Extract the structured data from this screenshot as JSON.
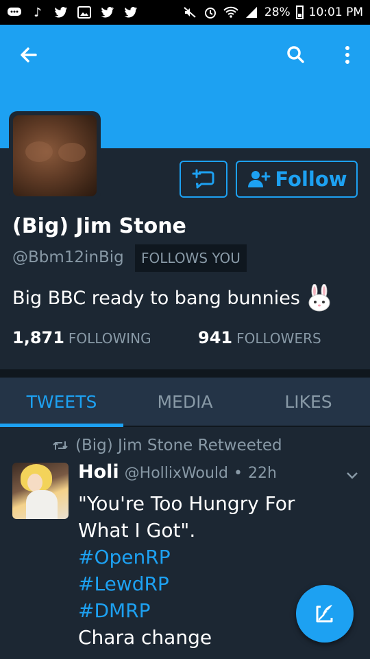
{
  "status_bar": {
    "battery_percent": "28%",
    "time": "10:01 PM"
  },
  "profile": {
    "name": "(Big) Jim Stone",
    "handle": "@Bbm12inBig",
    "follows_you_badge": "FOLLOWS YOU",
    "bio": "Big BBC ready to bang bunnies",
    "follow_label": "Follow",
    "following_count": "1,871",
    "following_label": "FOLLOWING",
    "followers_count": "941",
    "followers_label": "FOLLOWERS"
  },
  "tabs": [
    {
      "label": "TWEETS",
      "active": true
    },
    {
      "label": "MEDIA",
      "active": false
    },
    {
      "label": "LIKES",
      "active": false
    }
  ],
  "tweet": {
    "retweet_note": "(Big) Jim Stone Retweeted",
    "author_name": "Holi",
    "author_handle": "@HollixWould",
    "separator": "•",
    "time": "22h",
    "text_line1": "\"You're Too Hungry For",
    "text_line2": "What I Got\".",
    "hashtags": [
      "#OpenRP",
      "#LewdRP",
      "#DMRP"
    ],
    "text_line3": "Chara change"
  },
  "colors": {
    "accent": "#1da1f2",
    "background": "#1c2733",
    "tab_background": "#243447",
    "muted_text": "#8899a6"
  },
  "icons": {
    "back": "arrow-left-icon",
    "search": "search-icon",
    "more": "more-vertical-icon",
    "dm": "direct-message-icon",
    "follow": "add-user-icon",
    "bunny": "bunny-emoji-icon",
    "retweet": "retweet-icon",
    "caret": "chevron-down-icon",
    "compose": "compose-tweet-icon"
  }
}
